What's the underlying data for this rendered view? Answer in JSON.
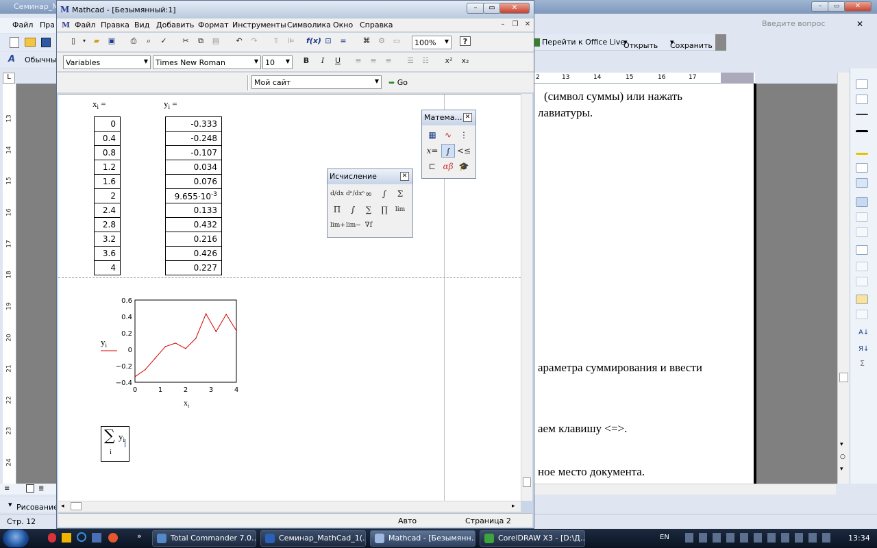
{
  "word": {
    "title": "Семинар_Ма",
    "menu": [
      "Файл",
      "Пра"
    ],
    "ask_placeholder": "Введите вопрос",
    "office_live": "Перейти к Office Live",
    "open": "Открыть",
    "save": "Сохранить",
    "style_box": "Обычны",
    "ruler_ticks": [
      "2",
      "13",
      "14",
      "15",
      "16",
      "17"
    ],
    "vruler_ticks": [
      "13",
      "14",
      "15",
      "16",
      "17",
      "18",
      "19",
      "20",
      "21",
      "22",
      "23",
      "24"
    ],
    "text_lines": [
      "(символ  суммы)  или  нажать",
      "лавиатуры.",
      "араметра суммирования и ввести",
      "аем клавишу <=>.",
      "ное место документа."
    ],
    "draw_label": "Рисование",
    "status_page": "Стр.  12"
  },
  "mathcad": {
    "title": "Mathcad - [Безымянный:1]",
    "menu": [
      "Файл",
      "Правка",
      "Вид",
      "Добавить",
      "Формат",
      "Инструменты",
      "Символика",
      "Окно",
      "Справка"
    ],
    "zoom": "100%",
    "style_select": "Variables",
    "font_select": "Times New Roman",
    "size_select": "10",
    "bold": "B",
    "italic": "I",
    "underline": "U",
    "superscript": "x²",
    "subscript": "x₂",
    "url_select": "Мой сайт",
    "go": "Go",
    "status_mode": "Авто",
    "status_page": "Страница 2"
  },
  "worksheet": {
    "x_label": "x",
    "x_sub": "i",
    "y_label": "y",
    "y_sub": "i",
    "eq": "=",
    "x_values": [
      "0",
      "0.4",
      "0.8",
      "1.2",
      "1.6",
      "2",
      "2.4",
      "2.8",
      "3.2",
      "3.6",
      "4"
    ],
    "y_values": [
      "-0.333",
      "-0.248",
      "-0.107",
      "0.034",
      "0.076",
      "9.655·10",
      "0.133",
      "0.432",
      "0.216",
      "0.426",
      "0.227"
    ],
    "y_exp": "-3",
    "sum_symbol": "∑",
    "sum_var": "y",
    "sum_sub": "i",
    "sum_index": "i"
  },
  "palette_math": {
    "title": "Матема…",
    "close": "✕"
  },
  "palette_calc": {
    "title": "Исчисление",
    "close": "✕"
  },
  "chart_data": {
    "type": "line",
    "x": [
      0,
      0.4,
      0.8,
      1.2,
      1.6,
      2,
      2.4,
      2.8,
      3.2,
      3.6,
      4
    ],
    "series": [
      {
        "values": [
          -0.333,
          -0.248,
          -0.107,
          0.034,
          0.076,
          0.009655,
          0.133,
          0.432,
          0.216,
          0.426,
          0.227
        ],
        "color": "#d40000"
      }
    ],
    "xlim": [
      0,
      4
    ],
    "ylim": [
      -0.4,
      0.6
    ],
    "xticks": [
      "0",
      "1",
      "2",
      "3",
      "4"
    ],
    "yticks": [
      "0.6",
      "0.4",
      "0.2",
      "0",
      "−0.2",
      "−0.4"
    ],
    "xlabel": "x",
    "xlabel_sub": "i",
    "ylabel": "y",
    "ylabel_sub": "i"
  },
  "taskbar": {
    "tasks": [
      "Total Commander 7.0…",
      "Семинар_MathCad_1(…",
      "Mathcad - [Безымянн…",
      "CorelDRAW X3 - [D:\\Д…"
    ],
    "lang": "EN",
    "clock": "13:34"
  }
}
